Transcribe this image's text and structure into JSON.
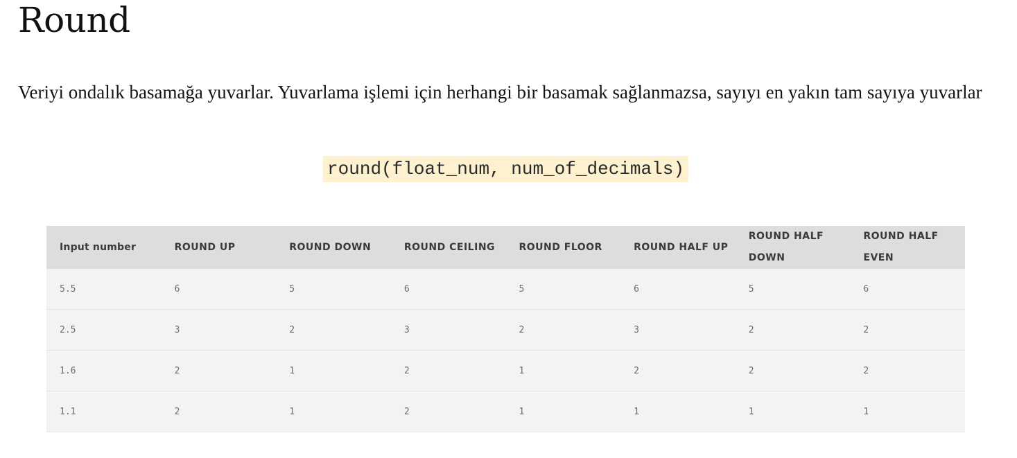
{
  "title": "Round",
  "description": "Veriyi ondalık basamağa yuvarlar. Yuvarlama işlemi için herhangi bir basamak sağlanmazsa, sayıyı en yakın tam sayıya yuvarlar",
  "code": "round(float_num, num_of_decimals)",
  "table": {
    "headers": [
      "Input number",
      "ROUND UP",
      "ROUND DOWN",
      "ROUND CEILING",
      "ROUND FLOOR",
      "ROUND HALF UP",
      "ROUND HALF DOWN",
      "ROUND HALF EVEN"
    ],
    "rows": [
      [
        "5.5",
        "6",
        "5",
        "6",
        "5",
        "6",
        "5",
        "6"
      ],
      [
        "2.5",
        "3",
        "2",
        "3",
        "2",
        "3",
        "2",
        "2"
      ],
      [
        "1.6",
        "2",
        "1",
        "2",
        "1",
        "2",
        "2",
        "2"
      ],
      [
        "1.1",
        "2",
        "1",
        "2",
        "1",
        "1",
        "1",
        "1"
      ]
    ]
  }
}
